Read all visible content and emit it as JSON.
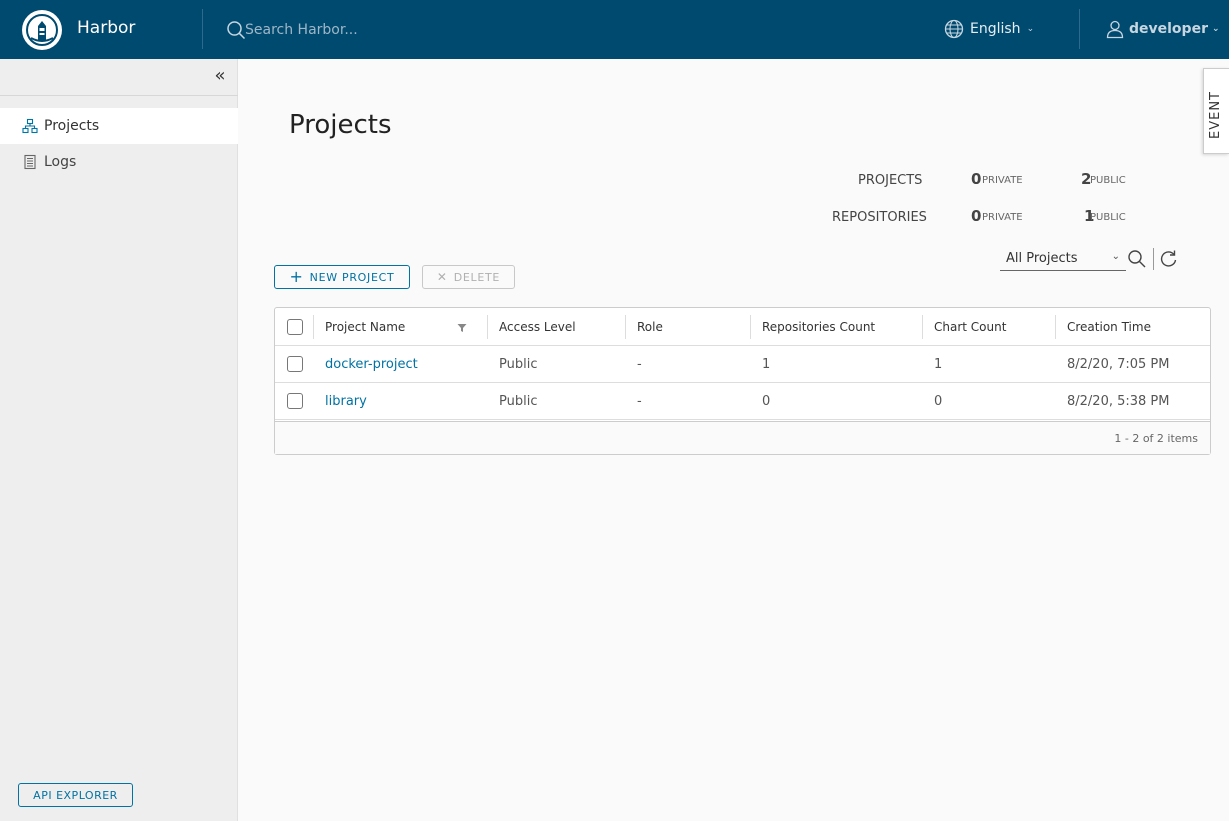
{
  "header": {
    "brand": "Harbor",
    "search_placeholder": "Search Harbor...",
    "language": "English",
    "user": "developer",
    "background_color": "#004a70"
  },
  "sidebar": {
    "items": [
      {
        "label": "Projects",
        "icon": "hierarchy-icon",
        "active": true
      },
      {
        "label": "Logs",
        "icon": "document-list-icon",
        "active": false
      }
    ],
    "api_explorer_label": "API EXPLORER"
  },
  "event_tab": {
    "label": "EVENT"
  },
  "main": {
    "title": "Projects",
    "summary": {
      "projects_label": "PROJECTS",
      "repositories_label": "REPOSITORIES",
      "projects_private": "0",
      "projects_public": "2",
      "repositories_private": "0",
      "repositories_public": "1",
      "private_unit": "PRIVATE",
      "public_unit": "PUBLIC"
    },
    "toolbar": {
      "new_project_label": "NEW PROJECT",
      "delete_label": "DELETE",
      "filter_selected": "All Projects"
    },
    "grid": {
      "columns": [
        "Project Name",
        "Access Level",
        "Role",
        "Repositories Count",
        "Chart Count",
        "Creation Time"
      ],
      "rows": [
        {
          "name": "docker-project",
          "access": "Public",
          "role": "-",
          "repos": "1",
          "charts": "1",
          "created": "8/2/20, 7:05 PM"
        },
        {
          "name": "library",
          "access": "Public",
          "role": "-",
          "repos": "0",
          "charts": "0",
          "created": "8/2/20, 5:38 PM"
        }
      ],
      "footer": "1 - 2 of 2 items"
    },
    "accent_color": "#0072a3"
  }
}
